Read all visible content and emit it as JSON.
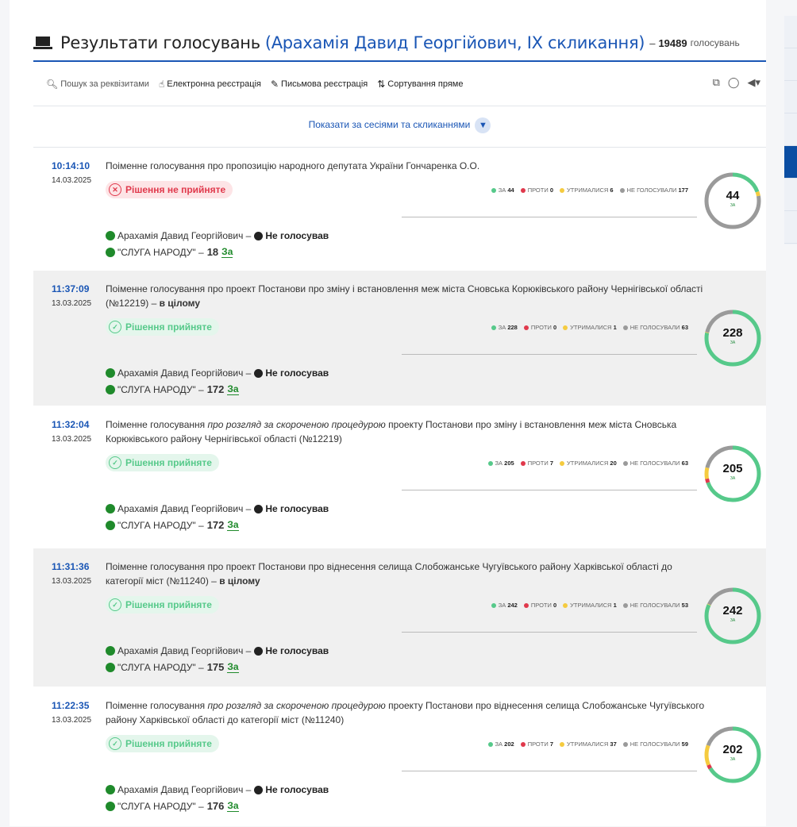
{
  "header": {
    "title": "Результати голосувань",
    "subtitle": "(Арахамія Давид Георгійович, IX скликання)",
    "dash": "–",
    "count": "19489",
    "count_unit": "голосувань"
  },
  "toolbar": {
    "search": "Пошук за реквізитами",
    "electronic": "Електронна реєстрація",
    "written": "Письмова реєстрація",
    "sort": "Сортування пряме"
  },
  "show_by": "Показати за сесіями та скликаннями",
  "legend_labels": {
    "za": "ЗА",
    "proty": "ПРОТИ",
    "utrym": "УТРИМАЛИСЯ",
    "ne": "НЕ ГОЛОСУВАЛИ"
  },
  "colors": {
    "za": "#56c98a",
    "proty": "#e0394c",
    "utrym": "#f5cb3f",
    "ne": "#9a9a9a",
    "accent": "#1a56b5"
  },
  "votes": [
    {
      "time": "10:14:10",
      "date": "14.03.2025",
      "desc_parts": [
        {
          "t": "Поіменне голосування про пропозицію народного депутата України Гончаренка О.О."
        }
      ],
      "status": "Рішення не прийняте",
      "status_ok": false,
      "za": "44",
      "proty": "0",
      "utrym": "6",
      "ne": "177",
      "donut_label": "ЗА",
      "deputy": "Арахамія Давид Георгійович –",
      "deputy_vote": "Не голосував",
      "faction": "\"СЛУГА НАРОДУ\" –",
      "faction_count": "18",
      "faction_vote": "За"
    },
    {
      "time": "11:37:09",
      "date": "13.03.2025",
      "desc_parts": [
        {
          "t": "Поіменне голосування про проект Постанови про зміну і встановлення меж міста Сновська Корюківського району Чернігівської області (№12219) – "
        },
        {
          "t": "в цілому",
          "b": true
        }
      ],
      "status": "Рішення прийняте",
      "status_ok": true,
      "za": "228",
      "proty": "0",
      "utrym": "1",
      "ne": "63",
      "donut_label": "ЗА",
      "deputy": "Арахамія Давид Георгійович –",
      "deputy_vote": "Не голосував",
      "faction": "\"СЛУГА НАРОДУ\" –",
      "faction_count": "172",
      "faction_vote": "За"
    },
    {
      "time": "11:32:04",
      "date": "13.03.2025",
      "desc_parts": [
        {
          "t": "Поіменне голосування "
        },
        {
          "t": "про розгляд за скороченою процедурою",
          "i": true
        },
        {
          "t": " проекту Постанови про зміну і встановлення меж міста Сновська Корюківського району Чернігівської області (№12219)"
        }
      ],
      "status": "Рішення прийняте",
      "status_ok": true,
      "za": "205",
      "proty": "7",
      "utrym": "20",
      "ne": "63",
      "donut_label": "ЗА",
      "deputy": "Арахамія Давид Георгійович –",
      "deputy_vote": "Не голосував",
      "faction": "\"СЛУГА НАРОДУ\" –",
      "faction_count": "172",
      "faction_vote": "За"
    },
    {
      "time": "11:31:36",
      "date": "13.03.2025",
      "desc_parts": [
        {
          "t": "Поіменне голосування про проект Постанови про віднесення селища Слобожанське Чугуївського району Харківської області до категорії міст (№11240) – "
        },
        {
          "t": "в цілому",
          "b": true
        }
      ],
      "status": "Рішення прийняте",
      "status_ok": true,
      "za": "242",
      "proty": "0",
      "utrym": "1",
      "ne": "53",
      "donut_label": "ЗА",
      "deputy": "Арахамія Давид Георгійович –",
      "deputy_vote": "Не голосував",
      "faction": "\"СЛУГА НАРОДУ\" –",
      "faction_count": "175",
      "faction_vote": "За"
    },
    {
      "time": "11:22:35",
      "date": "13.03.2025",
      "desc_parts": [
        {
          "t": "Поіменне голосування "
        },
        {
          "t": "про розгляд за скороченою процедурою",
          "i": true
        },
        {
          "t": " проекту Постанови про віднесення селища Слобожанське Чугуївського району Харківської області до категорії міст (№11240)"
        }
      ],
      "status": "Рішення прийняте",
      "status_ok": true,
      "za": "202",
      "proty": "7",
      "utrym": "37",
      "ne": "59",
      "donut_label": "ЗА",
      "deputy": "Арахамія Давид Георгійович –",
      "deputy_vote": "Не голосував",
      "faction": "\"СЛУГА НАРОДУ\" –",
      "faction_count": "176",
      "faction_vote": "За"
    }
  ]
}
